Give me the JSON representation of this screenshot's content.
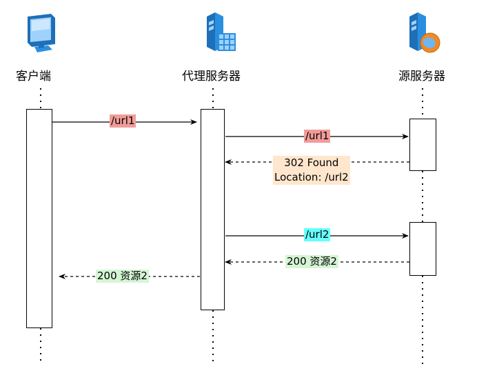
{
  "actors": {
    "client": {
      "label": "客户端",
      "icon": "monitor-icon"
    },
    "proxy": {
      "label": "代理服务器",
      "icon": "server-grid-icon"
    },
    "origin": {
      "label": "源服务器",
      "icon": "server-globe-icon"
    }
  },
  "messages": {
    "m1": {
      "label": "/url1",
      "highlight": "#f19c99",
      "style": "solid"
    },
    "m2": {
      "label": "/url1",
      "highlight": "#f19c99",
      "style": "solid"
    },
    "m3": {
      "label_line1": "302 Found",
      "label_line2": "Location: /url2",
      "highlight": "#ffe6cc",
      "style": "dashed"
    },
    "m4": {
      "label": "/url2",
      "highlight": "#66ffff",
      "style": "solid"
    },
    "m5": {
      "label": "200 资源2",
      "highlight": "#d5f5d5",
      "style": "dashed"
    },
    "m6": {
      "label": "200 资源2",
      "highlight": "#d5f5d5",
      "style": "dashed"
    }
  },
  "colors": {
    "line": "#000000",
    "icon_blue": "#2b8fe0",
    "icon_dark": "#1e6fb8",
    "globe_orange": "#f08a24"
  }
}
